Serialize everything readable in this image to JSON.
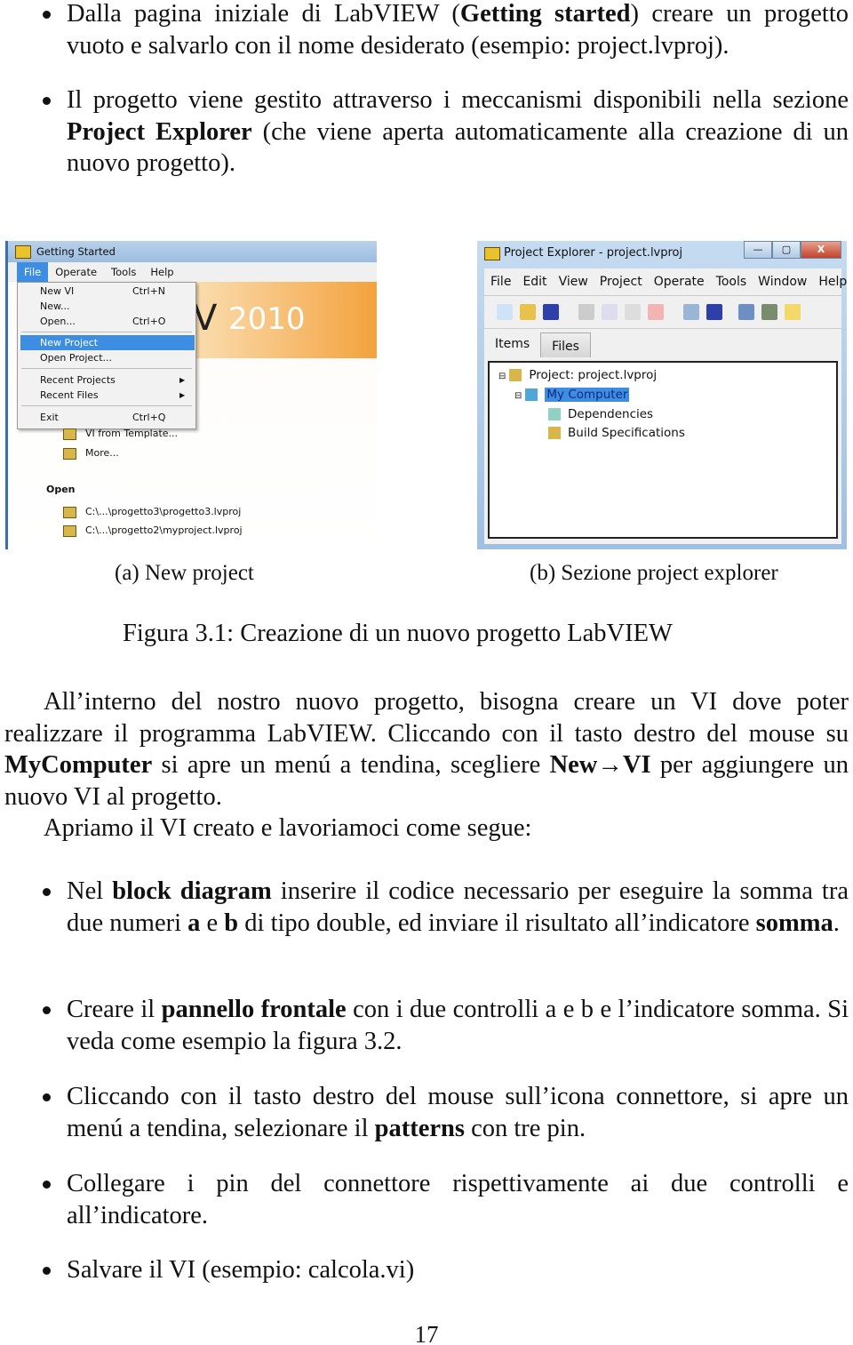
{
  "bullets_top": [
    {
      "parts": [
        [
          "Dalla pagina iniziale di LabVIEW (",
          false
        ],
        [
          "Getting started",
          true
        ],
        [
          ") creare un progetto vuoto e salvarlo con il nome desiderato (esempio: project.lvproj).",
          false
        ]
      ]
    },
    {
      "parts": [
        [
          "Il progetto viene gestito attraverso i meccanismi disponibili nella sezione ",
          false
        ],
        [
          "Project Explorer",
          true
        ],
        [
          " (che viene aperta automaticamente alla creazione di un nuovo progetto).",
          false
        ]
      ]
    }
  ],
  "figure": {
    "sub_a": {
      "caption": "(a) New project",
      "window_title": "Getting Started",
      "menubar": [
        "File",
        "Operate",
        "Tools",
        "Help"
      ],
      "banner_text": "2010",
      "menu_items": [
        {
          "label": "New VI",
          "shortcut": "Ctrl+N"
        },
        {
          "label": "New...",
          "shortcut": ""
        },
        {
          "label": "Open...",
          "shortcut": "Ctrl+O"
        },
        {
          "label": "New Project",
          "shortcut": "",
          "selected": true
        },
        {
          "label": "Open Project...",
          "shortcut": ""
        },
        {
          "label": "Recent Projects",
          "shortcut": "",
          "submenu": true
        },
        {
          "label": "Recent Files",
          "shortcut": "",
          "submenu": true
        },
        {
          "label": "Exit",
          "shortcut": "Ctrl+Q"
        }
      ],
      "links": [
        "VI from Template...",
        "More..."
      ],
      "open_heading": "Open",
      "recent": [
        "C:\\...\\progetto3\\progetto3.lvproj",
        "C:\\...\\progetto2\\myproject.lvproj"
      ]
    },
    "sub_b": {
      "caption": "(b) Sezione project explorer",
      "window_title": "Project Explorer - project.lvproj",
      "menubar": [
        "File",
        "Edit",
        "View",
        "Project",
        "Operate",
        "Tools",
        "Window",
        "Help"
      ],
      "tabs": [
        "Items",
        "Files"
      ],
      "tree": [
        {
          "label": "Project: project.lvproj"
        },
        {
          "label": "My Computer",
          "selected": true
        },
        {
          "label": "Dependencies"
        },
        {
          "label": "Build Specifications"
        }
      ]
    },
    "caption": "Figura 3.1: Creazione di un nuovo progetto LabVIEW"
  },
  "paragraph1": {
    "parts": [
      [
        "All’interno del nostro nuovo progetto, bisogna creare un VI dove poter realizzare il programma LabVIEW. Cliccando con il tasto destro del mouse su ",
        false
      ],
      [
        "MyComputer",
        true
      ],
      [
        " si apre un menú a tendina, scegliere ",
        false
      ],
      [
        "New→VI",
        true
      ],
      [
        " per aggiungere un nuovo VI al progetto.",
        false
      ]
    ]
  },
  "paragraph2": "Apriamo il VI creato e lavoriamoci come segue:",
  "bullets_bottom": [
    {
      "parts": [
        [
          "Nel ",
          false
        ],
        [
          "block diagram",
          true
        ],
        [
          " inserire il codice necessario per eseguire la somma tra due numeri ",
          false
        ],
        [
          "a",
          true
        ],
        [
          " e ",
          false
        ],
        [
          "b",
          true
        ],
        [
          " di tipo double, ed inviare il risultato all’indicatore ",
          false
        ],
        [
          "somma",
          true
        ],
        [
          ".",
          false
        ]
      ]
    },
    {
      "parts": [
        [
          "Creare il ",
          false
        ],
        [
          "pannello frontale",
          true
        ],
        [
          " con i due controlli a e b e l’indicatore somma. Si veda come esempio la figura 3.2.",
          false
        ]
      ]
    },
    {
      "parts": [
        [
          "Cliccando con il tasto destro del mouse sull’icona connettore, si apre un menú a tendina, selezionare il ",
          false
        ],
        [
          "patterns",
          true
        ],
        [
          " con tre pin.",
          false
        ]
      ]
    },
    {
      "parts": [
        [
          "Collegare i pin del connettore rispettivamente ai due controlli e all’indicatore.",
          false
        ]
      ]
    },
    {
      "parts": [
        [
          "Salvare il VI (esempio: calcola.vi)",
          false
        ]
      ]
    }
  ],
  "page_number": "17"
}
